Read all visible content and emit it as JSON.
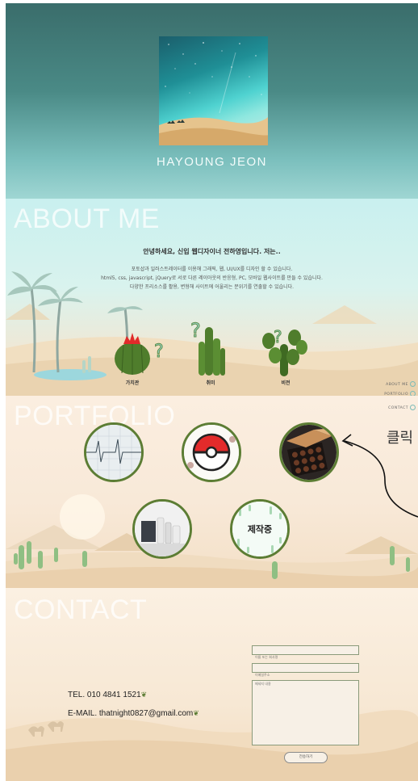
{
  "hero": {
    "name": "HAYOUNG JEON"
  },
  "about": {
    "section_title": "ABOUT ME",
    "heading": "안녕하세요, 신입 웹디자이너 전하영입니다. 저는..",
    "lines": [
      "포토샵과 일러스트레이터를 이용해 그래픽, 웹, UI/UX를 디자인 할 수 있습니다.",
      "html5, css, javascript, jQuery로 서로 다른 레이아웃의 반응형, PC, 모바일 웹사이트를 만들 수 있습니다.",
      "다양한 프리소스를 활용, 변형해 사이트에 어울리는 분위기를 연출할 수 있습니다."
    ],
    "plants": [
      {
        "label": "가치관"
      },
      {
        "label": "취미"
      },
      {
        "label": "비전"
      }
    ]
  },
  "side_nav": {
    "items": [
      "ABOUT ME",
      "PORTFOLIO",
      "CONTACT"
    ]
  },
  "portfolio": {
    "section_title": "PORTFOLIO",
    "click_hint": "클릭",
    "in_progress_label": "제작중"
  },
  "contact": {
    "section_title": "CONTACT",
    "tel": "TEL. 010 4841 1521",
    "email": "E-MAIL. thatnight0827@gmail.com",
    "name_placeholder": "이름 또는 회사명",
    "email_placeholder": "이메일주소",
    "message_placeholder": "메세지 내용",
    "send_label": "전송하기"
  },
  "colors": {
    "accent_green": "#5c7d34",
    "hero_teal": "#3a6d6b"
  }
}
